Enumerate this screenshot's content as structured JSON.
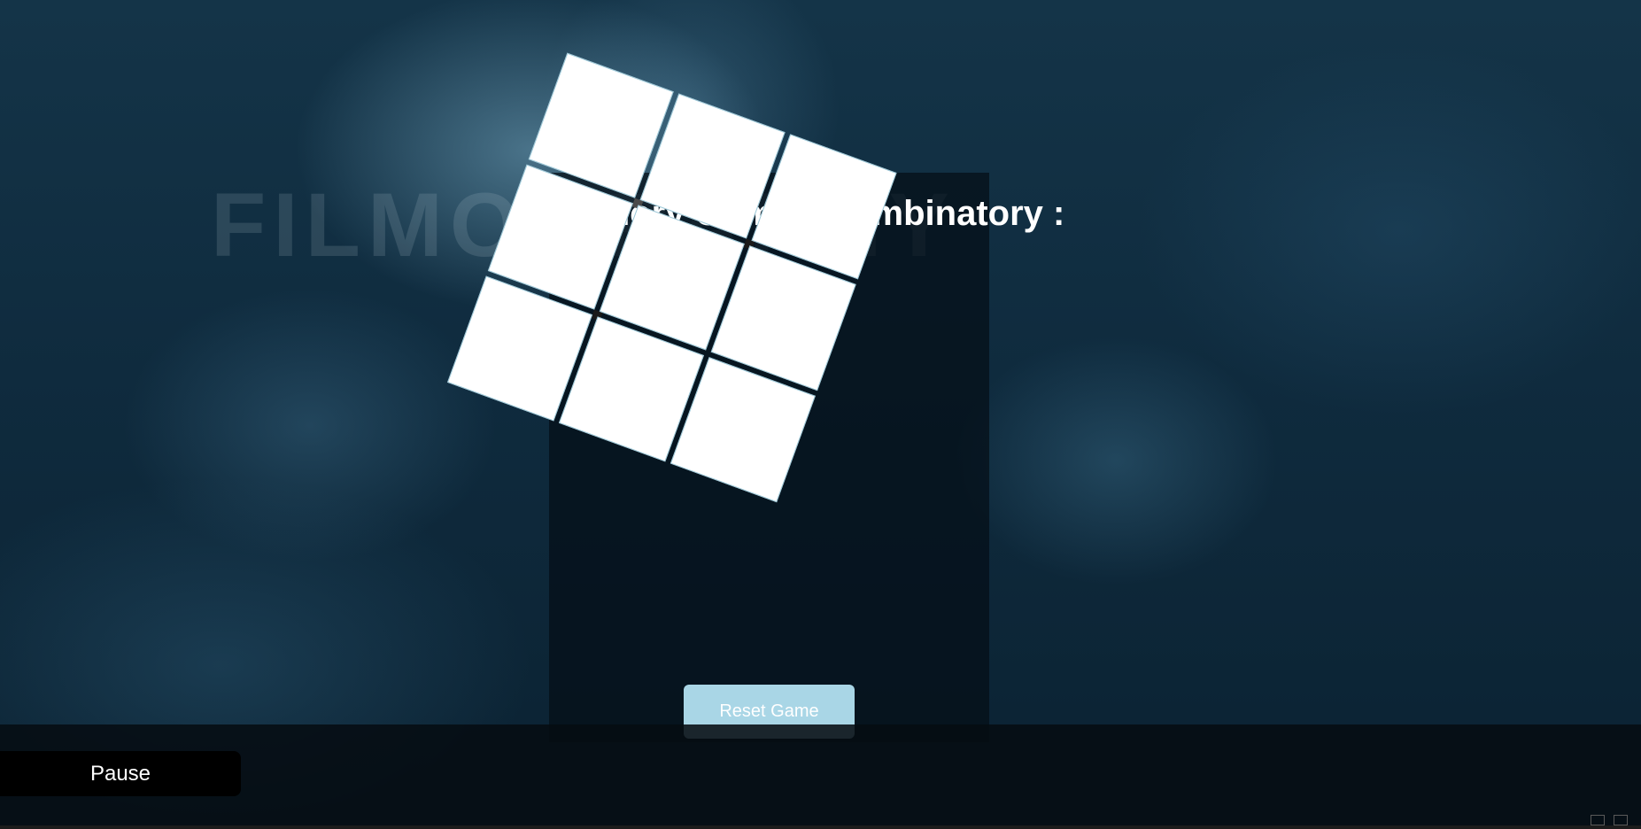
{
  "brand": {
    "watermark_text": "FILMOGRAPHY"
  },
  "game": {
    "title": "Memory Game - Combinatory :",
    "reset_label": "Reset Game",
    "grid_rows": 3,
    "grid_cols": 3,
    "cards": [
      {
        "id": 1,
        "face": "hidden"
      },
      {
        "id": 2,
        "face": "hidden"
      },
      {
        "id": 3,
        "face": "hidden"
      },
      {
        "id": 4,
        "face": "hidden"
      },
      {
        "id": 5,
        "face": "hidden"
      },
      {
        "id": 6,
        "face": "hidden"
      },
      {
        "id": 7,
        "face": "hidden"
      },
      {
        "id": 8,
        "face": "hidden"
      },
      {
        "id": 9,
        "face": "hidden"
      }
    ]
  },
  "controls": {
    "pause_label": "Pause"
  },
  "colors": {
    "background": "#0f2b3e",
    "card_face": "#ffffff",
    "card_border": "#9cc8d8",
    "reset_button": "#a9d6e6",
    "pause_button": "#000000"
  }
}
